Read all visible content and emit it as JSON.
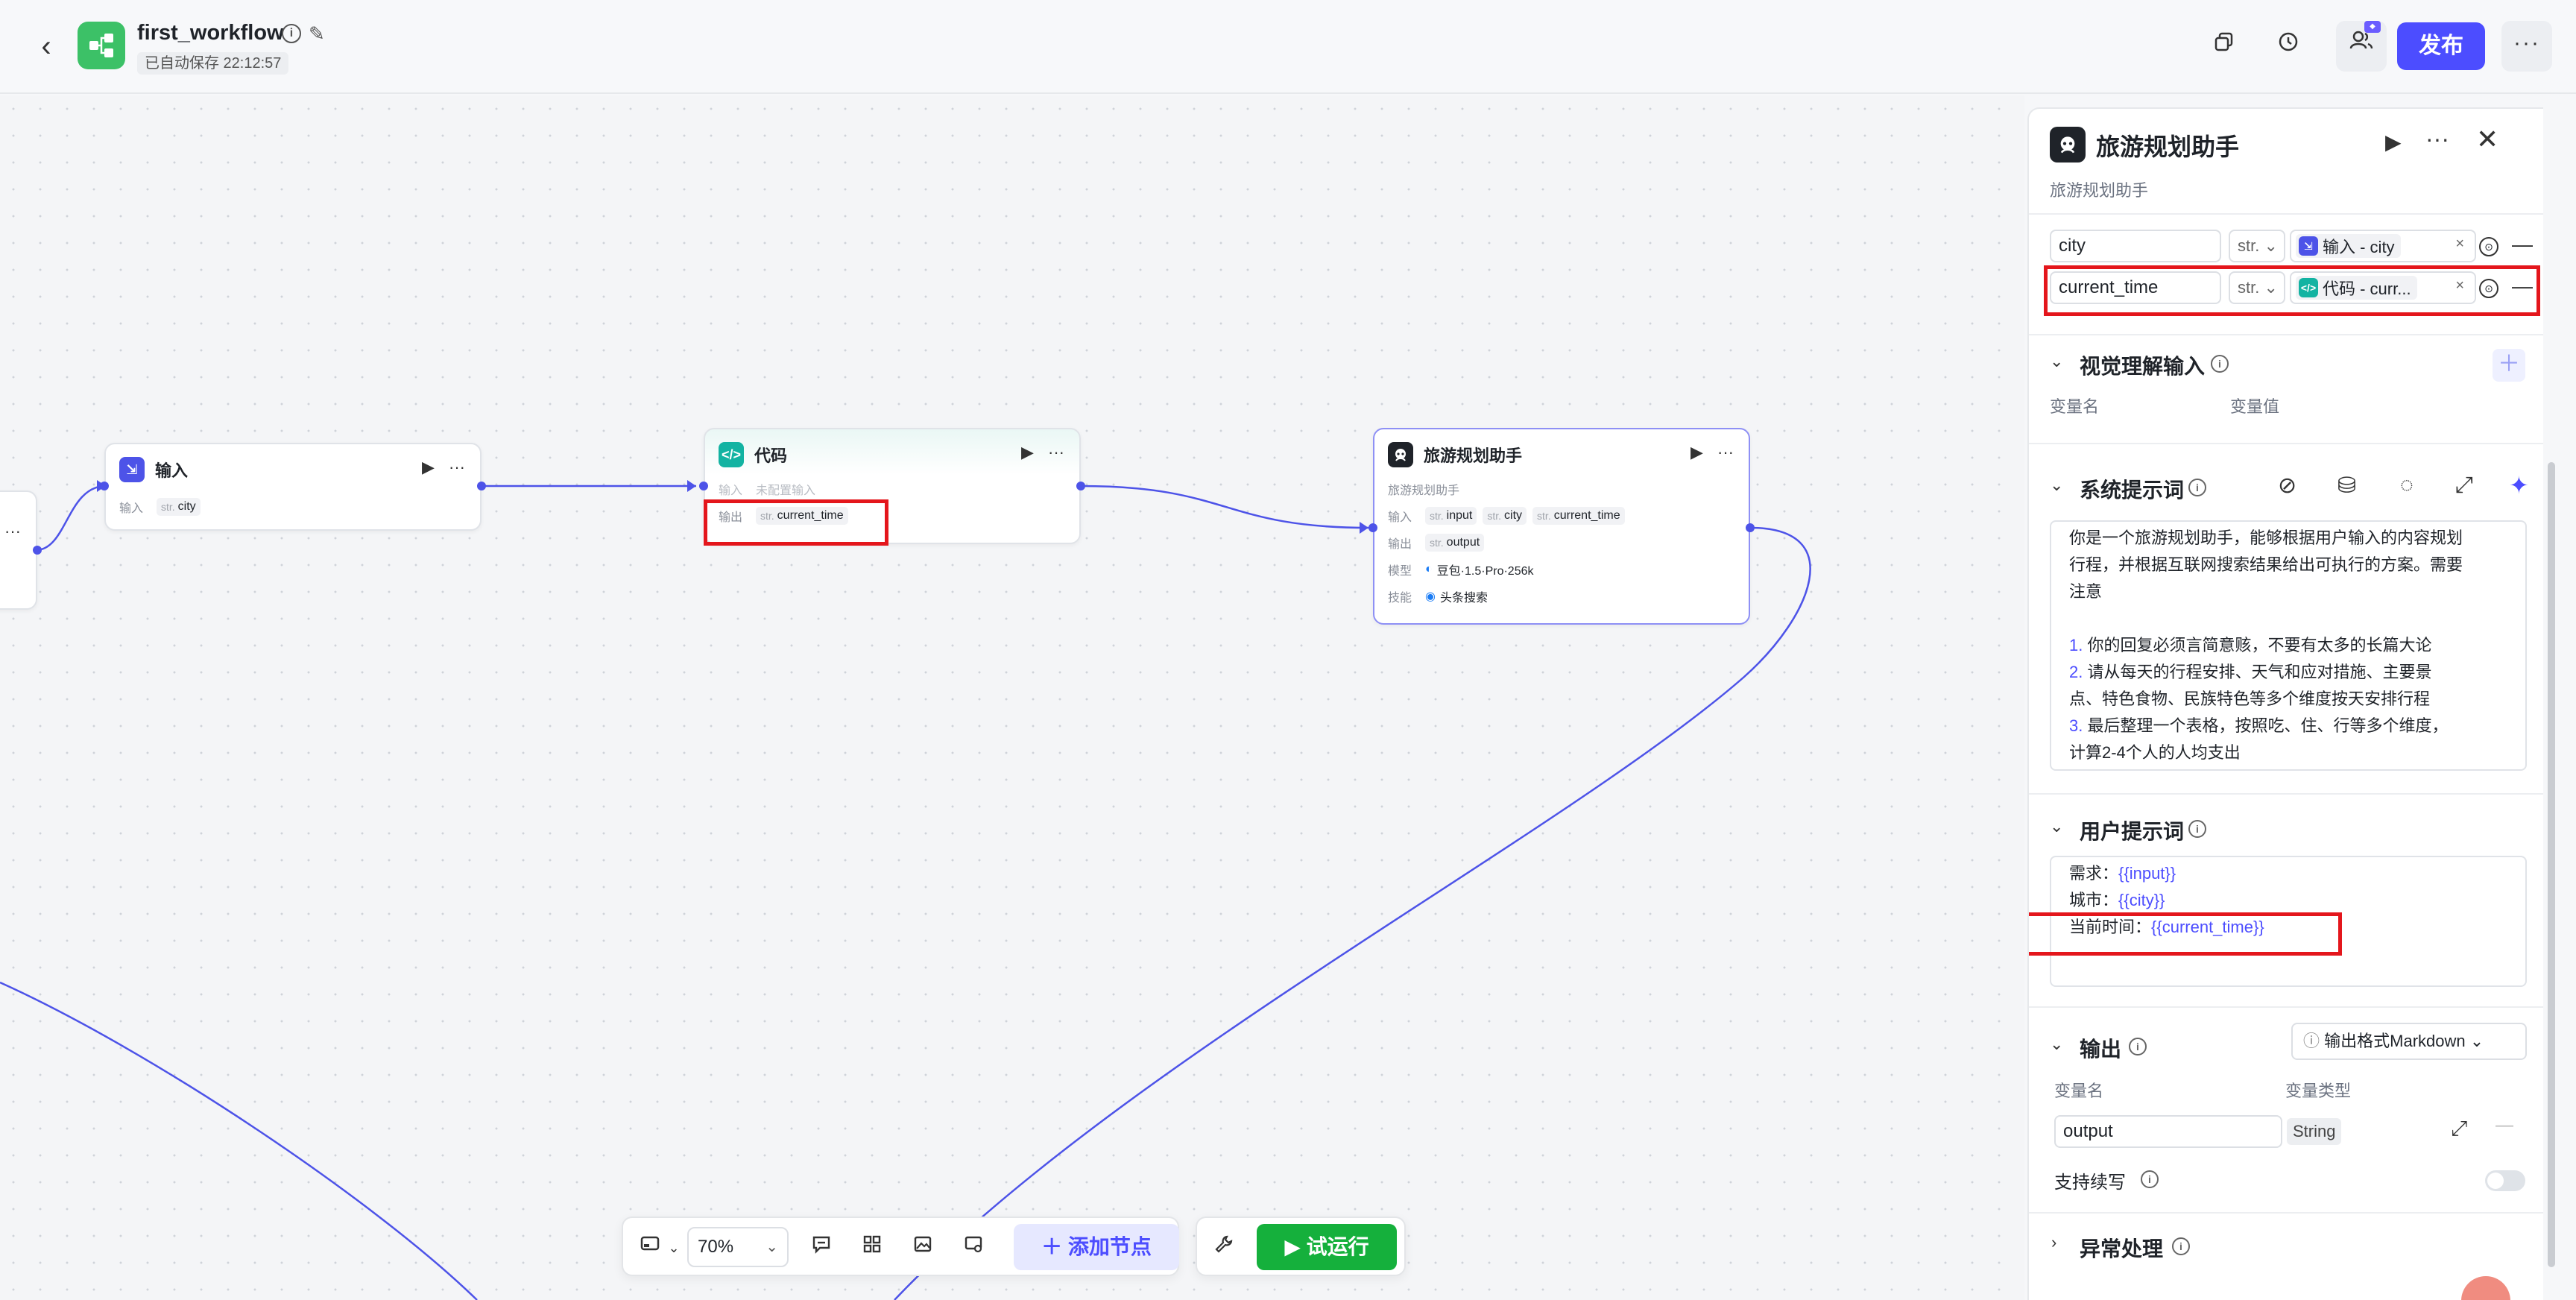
{
  "header": {
    "back_icon": "chevron-left-icon",
    "app_title": "first_workflow",
    "autosave": "已自动保存 22:12:57",
    "publish_label": "发布"
  },
  "canvas": {
    "nodes": {
      "input": {
        "title": "输入",
        "row_label": "输入",
        "var_type": "str.",
        "var_name": "city"
      },
      "code": {
        "title": "代码",
        "input_placeholder_label": "输入",
        "input_placeholder": "未配置输入",
        "output_label": "输出",
        "output_type": "str.",
        "output_name": "current_time"
      },
      "llm": {
        "title": "旅游规划助手",
        "subtitle": "旅游规划助手",
        "input_label": "输入",
        "inputs": [
          {
            "type": "str.",
            "name": "input"
          },
          {
            "type": "str.",
            "name": "city"
          },
          {
            "type": "str.",
            "name": "current_time"
          }
        ],
        "output_label": "输出",
        "output_type": "str.",
        "output_name": "output",
        "model_label": "模型",
        "model": "豆包·1.5·Pro·256k",
        "skill_label": "技能",
        "skill": "头条搜索"
      }
    },
    "toolbar": {
      "zoom": "70%",
      "add_node_label": "添加节点",
      "run_label": "试运行"
    }
  },
  "panel": {
    "title": "旅游规划助手",
    "subtitle": "旅游规划助手",
    "input_rows": [
      {
        "name": "city",
        "type": "str.",
        "ref": "输入 - city",
        "ref_kind": "input"
      },
      {
        "name": "current_time",
        "type": "str.",
        "ref": "代码 - curr...",
        "ref_kind": "code"
      }
    ],
    "vision": {
      "title": "视觉理解输入",
      "col_name": "变量名",
      "col_value": "变量值"
    },
    "system_prompt": {
      "title": "系统提示词",
      "line1": "你是一个旅游规划助手，能够根据用户输入的内容规划",
      "line2": "行程，并根据互联网搜索结果给出可执行的方案。需要",
      "line3": "注意",
      "item1_num": "1.",
      "item1": " 你的回复必须言简意赅，不要有太多的长篇大论",
      "item2_num": "2.",
      "item2a": " 请从每天的行程安排、天气和应对措施、主要景",
      "item2b": "点、特色食物、民族特色等多个维度按天安排行程",
      "item3_num": "3.",
      "item3a": " 最后整理一个表格，按照吃、住、行等多个维度，",
      "item3b": "计算2-4个人的人均支出"
    },
    "user_prompt": {
      "title": "用户提示词",
      "l1_label": "需求：",
      "l1_var": "{{input}}",
      "l2_label": "城市：",
      "l2_var": "{{city}}",
      "l3_label": "当前时间：",
      "l3_var": "{{current_time}}"
    },
    "output": {
      "title": "输出",
      "format_label": "输出格式Markdown",
      "col_name": "变量名",
      "col_type": "变量类型",
      "var_name": "output",
      "var_type": "String",
      "continue_label": "支持续写"
    },
    "exception": {
      "title": "异常处理"
    }
  },
  "colors": {
    "accent": "#4c4dff",
    "run": "#15b03c",
    "highlight": "#e4161c",
    "input_icon": "#4d53e8",
    "code_icon": "#13b3a2",
    "edge": "#4d53e8"
  }
}
